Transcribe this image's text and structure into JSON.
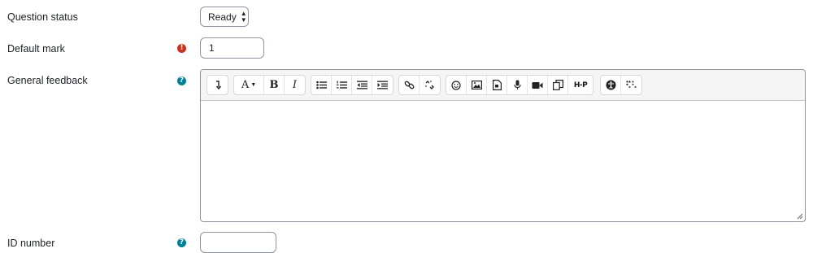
{
  "question_status": {
    "label": "Question status",
    "value": "Ready"
  },
  "default_mark": {
    "label": "Default mark",
    "value": "1",
    "indicator": "!"
  },
  "general_feedback": {
    "label": "General feedback",
    "help_indicator": "?",
    "content": "",
    "toolbar": {
      "groups": [
        [
          "show-more-buttons-icon"
        ],
        [
          "font-style-icon",
          "bold-icon",
          "italic-icon"
        ],
        [
          "unordered-list-icon",
          "ordered-list-icon",
          "outdent-icon",
          "indent-icon"
        ],
        [
          "link-icon",
          "unlink-icon"
        ],
        [
          "emoji-icon",
          "image-icon",
          "media-icon",
          "record-audio-icon",
          "record-video-icon",
          "manage-files-icon",
          "h5p-icon"
        ],
        [
          "accessibility-checker-icon",
          "screenreader-helper-icon"
        ]
      ],
      "h5p_text": "H-P",
      "font_letter": "A",
      "bold_letter": "B",
      "italic_letter": "I"
    }
  },
  "id_number": {
    "label": "ID number",
    "value": "",
    "help_indicator": "?"
  },
  "colors": {
    "required": "#ca3120",
    "help": "#008196",
    "border": "#8f959e"
  }
}
